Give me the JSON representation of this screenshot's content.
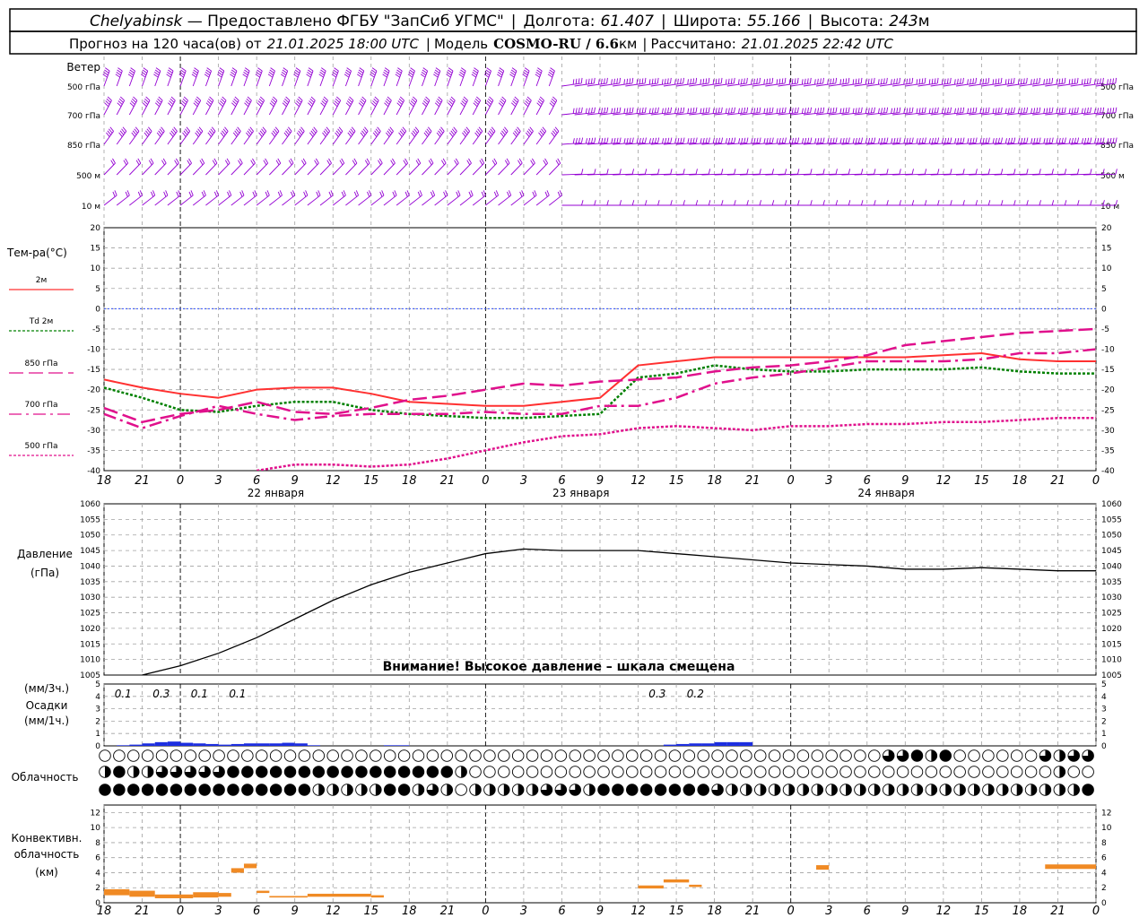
{
  "header": {
    "line1": {
      "station": "Chelyabinsk",
      "dash": " — ",
      "provider": "Предоставлено ФГБУ \"ЗапСиб УГМС\"",
      "lon_label": "Долгота:",
      "lon_value": "61.407",
      "lat_label": "Широта:",
      "lat_value": "55.166",
      "alt_label": "Высота:",
      "alt_value": "243",
      "alt_unit": "м"
    },
    "line2": {
      "forecast_label": "Прогноз на 120 часа(ов) от",
      "forecast_from": "21.01.2025 18:00 UTC",
      "model_label": "Модель",
      "model_name": "COSMO-RU / 6.6",
      "model_unit": "км",
      "calc_label": "Рассчитано:",
      "calc_time": "21.01.2025 22:42 UTC"
    }
  },
  "wind_panel": {
    "title": "Ветер",
    "levels": [
      "500 гПа",
      "700 гПа",
      "850 гПа",
      "500 м",
      "10 м"
    ],
    "color": "#9400d3"
  },
  "time_axis": {
    "hour_labels": [
      "18",
      "21",
      "0",
      "3",
      "6",
      "9",
      "12",
      "15",
      "18",
      "21",
      "0",
      "3",
      "6",
      "9",
      "12",
      "15",
      "18",
      "21",
      "0",
      "3",
      "6",
      "9",
      "12",
      "15",
      "18",
      "21",
      "0"
    ],
    "day_labels": [
      "22 января",
      "23 января",
      "24 января"
    ]
  },
  "temp_panel": {
    "title": "Тем-ра(°C)",
    "legend": [
      {
        "label": "2м",
        "color": "#ff3030",
        "style": "solid"
      },
      {
        "label": "Td  2м",
        "color": "#008000",
        "style": "dotted"
      },
      {
        "label": "850 гПа",
        "color": "#e0108c",
        "style": "longdash"
      },
      {
        "label": "700 гПа",
        "color": "#e0108c",
        "style": "dashdot"
      },
      {
        "label": "500 гПа",
        "color": "#e0108c",
        "style": "dotted"
      }
    ],
    "tick_labels": [
      "20",
      "15",
      "10",
      "5",
      "0",
      "-5",
      "-10",
      "-15",
      "-20",
      "-25",
      "-30",
      "-35",
      "-40"
    ]
  },
  "pressure_panel": {
    "title": "Давление",
    "unit": "(гПа)",
    "tick_labels": [
      "1060",
      "1055",
      "1050",
      "1045",
      "1040",
      "1035",
      "1030",
      "1025",
      "1020",
      "1015",
      "1010",
      "1005"
    ],
    "warning": "Внимание! Высокое давление – шкала смещена"
  },
  "precip_panel": {
    "unit3h": "(мм/3ч.)",
    "title": "Осадки",
    "unit1h": "(мм/1ч.)",
    "tick_labels": [
      "5",
      "4",
      "3",
      "2",
      "1",
      "0"
    ],
    "amount_labels": [
      {
        "hour": 3,
        "text": "0.1"
      },
      {
        "hour": 6,
        "text": "0.3"
      },
      {
        "hour": 9,
        "text": "0.1"
      },
      {
        "hour": 12,
        "text": "0.1"
      },
      {
        "hour": 45,
        "text": "0.3"
      },
      {
        "hour": 48,
        "text": "0.2"
      }
    ]
  },
  "cloud_panel": {
    "title": "Облачность"
  },
  "conv_panel": {
    "title_line1": "Конвективн.",
    "title_line2": "облачность",
    "unit": "(км)",
    "tick_labels": [
      "12",
      "10",
      "8",
      "6",
      "4",
      "2",
      "0"
    ],
    "color": "#f08a24"
  },
  "chart_data": {
    "type": "line",
    "x_unit": "hours since 21.01.2025 18:00 UTC",
    "x_range": [
      0,
      78
    ],
    "temperature": {
      "ylim": [
        -40,
        20
      ],
      "series": [
        {
          "name": "2м",
          "x": [
            0,
            3,
            6,
            9,
            12,
            15,
            18,
            21,
            24,
            27,
            30,
            33,
            36,
            39,
            42,
            45,
            48,
            51,
            54,
            57,
            60,
            63,
            66,
            69,
            72,
            75,
            78
          ],
          "values": [
            -17.5,
            -19.5,
            -21,
            -22,
            -20,
            -19.5,
            -19.5,
            -21,
            -23,
            -23.5,
            -24,
            -24,
            -23,
            -22,
            -14,
            -13,
            -12,
            -12,
            -12,
            -12,
            -12,
            -12,
            -11.5,
            -11,
            -12.5,
            -13,
            -13
          ]
        },
        {
          "name": "Td  2м",
          "x": [
            0,
            3,
            6,
            9,
            12,
            15,
            18,
            21,
            24,
            27,
            30,
            33,
            36,
            39,
            42,
            45,
            48,
            51,
            54,
            57,
            60,
            63,
            66,
            69,
            72,
            75,
            78
          ],
          "values": [
            -19.5,
            -22,
            -25,
            -25.5,
            -24,
            -23,
            -23,
            -25,
            -26,
            -26.5,
            -27,
            -27,
            -26.5,
            -26,
            -17,
            -16,
            -14,
            -15,
            -15.5,
            -15.5,
            -15,
            -15,
            -15,
            -14.5,
            -15.5,
            -16,
            -16
          ]
        },
        {
          "name": "850 гПа",
          "x": [
            0,
            3,
            6,
            9,
            12,
            15,
            18,
            21,
            24,
            27,
            30,
            33,
            36,
            39,
            42,
            45,
            48,
            51,
            54,
            57,
            60,
            63,
            66,
            69,
            72,
            75,
            78
          ],
          "values": [
            -24.5,
            -28,
            -26,
            -25,
            -23,
            -25.5,
            -26,
            -24.5,
            -22.5,
            -21.5,
            -20,
            -18.5,
            -19,
            -18,
            -17.5,
            -17,
            -15.5,
            -14.5,
            -14,
            -13,
            -11.5,
            -9,
            -8,
            -7,
            -6,
            -5.5,
            -5
          ]
        },
        {
          "name": "700 гПа",
          "x": [
            0,
            3,
            6,
            9,
            12,
            15,
            18,
            21,
            24,
            27,
            30,
            33,
            36,
            39,
            42,
            45,
            48,
            51,
            54,
            57,
            60,
            63,
            66,
            69,
            72,
            75,
            78
          ],
          "values": [
            -26,
            -29.5,
            -26.5,
            -24,
            -26,
            -27.5,
            -26.5,
            -26,
            -26,
            -26,
            -25.5,
            -26,
            -26,
            -24,
            -24,
            -22,
            -18.5,
            -17,
            -16,
            -14.5,
            -13,
            -13,
            -13,
            -12.5,
            -11,
            -11,
            -10
          ]
        },
        {
          "name": "500 гПа",
          "x": [
            12,
            15,
            18,
            21,
            24,
            27,
            30,
            33,
            36,
            39,
            42,
            45,
            48,
            51,
            54,
            57,
            60,
            63,
            66,
            69,
            72,
            75,
            78
          ],
          "values": [
            -40,
            -38.5,
            -38.5,
            -39,
            -38.5,
            -37,
            -35,
            -33,
            -31.5,
            -31,
            -29.5,
            -29,
            -29.5,
            -30,
            -29,
            -29,
            -28.5,
            -28.5,
            -28,
            -28,
            -27.5,
            -27,
            -27
          ]
        }
      ]
    },
    "pressure": {
      "ylim": [
        1005,
        1060
      ],
      "x": [
        3,
        6,
        9,
        12,
        15,
        18,
        21,
        24,
        27,
        30,
        33,
        36,
        39,
        42,
        45,
        48,
        51,
        54,
        57,
        60,
        63,
        66,
        69,
        72,
        75,
        78
      ],
      "values": [
        1005,
        1008,
        1012,
        1017,
        1023,
        1029,
        1034,
        1038,
        1041,
        1044,
        1045.5,
        1045,
        1045,
        1045,
        1044,
        1043,
        1042,
        1041,
        1040.5,
        1040,
        1039,
        1039,
        1039.5,
        1039,
        1038.5,
        1038.5
      ]
    },
    "precipitation": {
      "ylim": [
        0,
        5
      ],
      "x": [
        0,
        1,
        2,
        3,
        4,
        5,
        6,
        7,
        8,
        9,
        10,
        11,
        12,
        13,
        14,
        15,
        16,
        17,
        18,
        19,
        20,
        21,
        22,
        23,
        24,
        25,
        26,
        27,
        28,
        29,
        30,
        31,
        32,
        33,
        34,
        35,
        36,
        37,
        38,
        39,
        40,
        41,
        42,
        43,
        44,
        45,
        46,
        47,
        48,
        49,
        50
      ],
      "values": [
        0,
        0.05,
        0.1,
        0.2,
        0.3,
        0.35,
        0.25,
        0.2,
        0.15,
        0.1,
        0.15,
        0.2,
        0.2,
        0.2,
        0.25,
        0.2,
        0.05,
        0,
        0,
        0,
        0,
        0,
        0.05,
        0.05,
        0,
        0,
        0,
        0,
        0,
        0,
        0,
        0,
        0,
        0,
        0,
        0,
        0,
        0,
        0,
        0,
        0,
        0,
        0,
        0,
        0.1,
        0.15,
        0.2,
        0.2,
        0.3,
        0.3,
        0.3
      ]
    },
    "convective_cloud": {
      "ylim": [
        0,
        13
      ],
      "segments": [
        {
          "x0": 0,
          "x1": 2,
          "base": 1,
          "top": 1.8
        },
        {
          "x0": 2,
          "x1": 4,
          "base": 0.8,
          "top": 1.6
        },
        {
          "x0": 4,
          "x1": 7,
          "base": 0.6,
          "top": 1.1
        },
        {
          "x0": 7,
          "x1": 9,
          "base": 0.7,
          "top": 1.4
        },
        {
          "x0": 9,
          "x1": 10,
          "base": 0.8,
          "top": 1.3
        },
        {
          "x0": 10,
          "x1": 11,
          "base": 4,
          "top": 4.6
        },
        {
          "x0": 11,
          "x1": 12,
          "base": 4.6,
          "top": 5.2
        },
        {
          "x0": 12,
          "x1": 13,
          "base": 1.3,
          "top": 1.6
        },
        {
          "x0": 13,
          "x1": 16,
          "base": 0.7,
          "top": 0.9
        },
        {
          "x0": 16,
          "x1": 21,
          "base": 0.8,
          "top": 1.2
        },
        {
          "x0": 21,
          "x1": 22,
          "base": 0.7,
          "top": 1.0
        },
        {
          "x0": 42,
          "x1": 44,
          "base": 1.9,
          "top": 2.3
        },
        {
          "x0": 44,
          "x1": 46,
          "base": 2.7,
          "top": 3.1
        },
        {
          "x0": 46,
          "x1": 47,
          "base": 2.1,
          "top": 2.4
        },
        {
          "x0": 56,
          "x1": 57,
          "base": 4.4,
          "top": 5.0
        },
        {
          "x0": 74,
          "x1": 78,
          "base": 4.5,
          "top": 5.1
        }
      ]
    },
    "cloud_rows": {
      "row1": "000000000000000000000000000000000000000000000000000000033424000000323333434444444444443444444444444444444444444432",
      "row2": "24223333344444444444444442000000000000000000000000000000000000000002004444444444444444444444444444444444444444444444",
      "row3": "44444444444444422222442320222223332444444443222222222222222222222222244444444420324444444444324000000000000000000000"
    }
  }
}
